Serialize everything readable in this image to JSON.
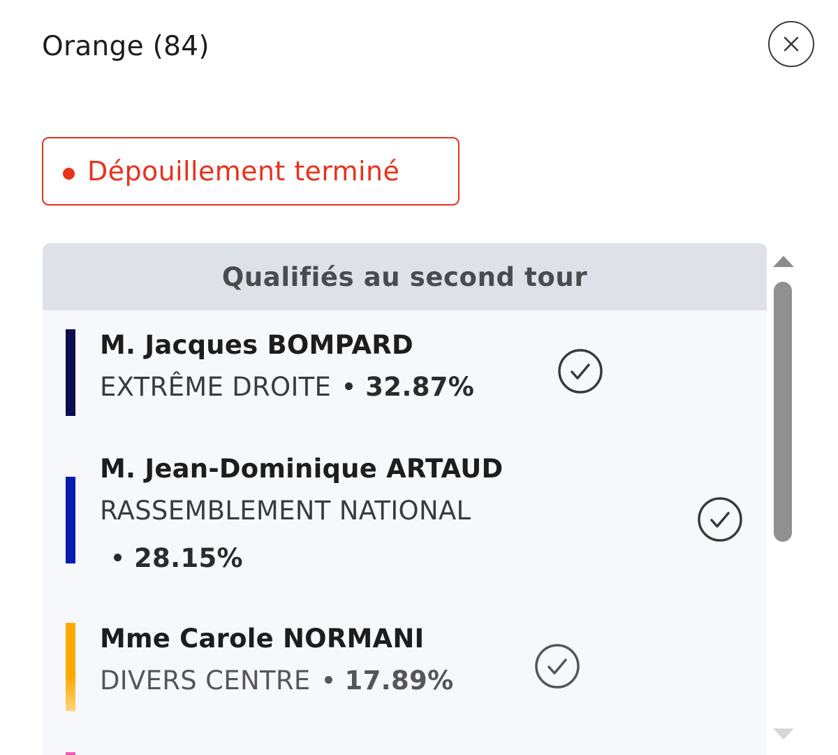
{
  "header": {
    "title": "Orange (84)",
    "close_icon": "close-icon"
  },
  "status": {
    "label": "Dépouillement terminé",
    "color": "#e8321c"
  },
  "panel": {
    "heading": "Qualifiés au second tour",
    "candidates": [
      {
        "name": "M. Jacques BOMPARD",
        "party": "EXTRÊME DROITE",
        "percent": "32.87%",
        "color": "#0b0d4f",
        "qualified_icon": "check-circle-icon"
      },
      {
        "name": "M. Jean-Dominique ARTAUD",
        "party": "RASSEMBLEMENT NATIONAL",
        "percent": "28.15%",
        "color": "#0a1bb0",
        "qualified_icon": "check-circle-icon"
      },
      {
        "name": "Mme Carole NORMANI",
        "party": "DIVERS CENTRE",
        "percent": "17.89%",
        "color": "#ffa800",
        "qualified_icon": "check-circle-icon"
      }
    ]
  }
}
